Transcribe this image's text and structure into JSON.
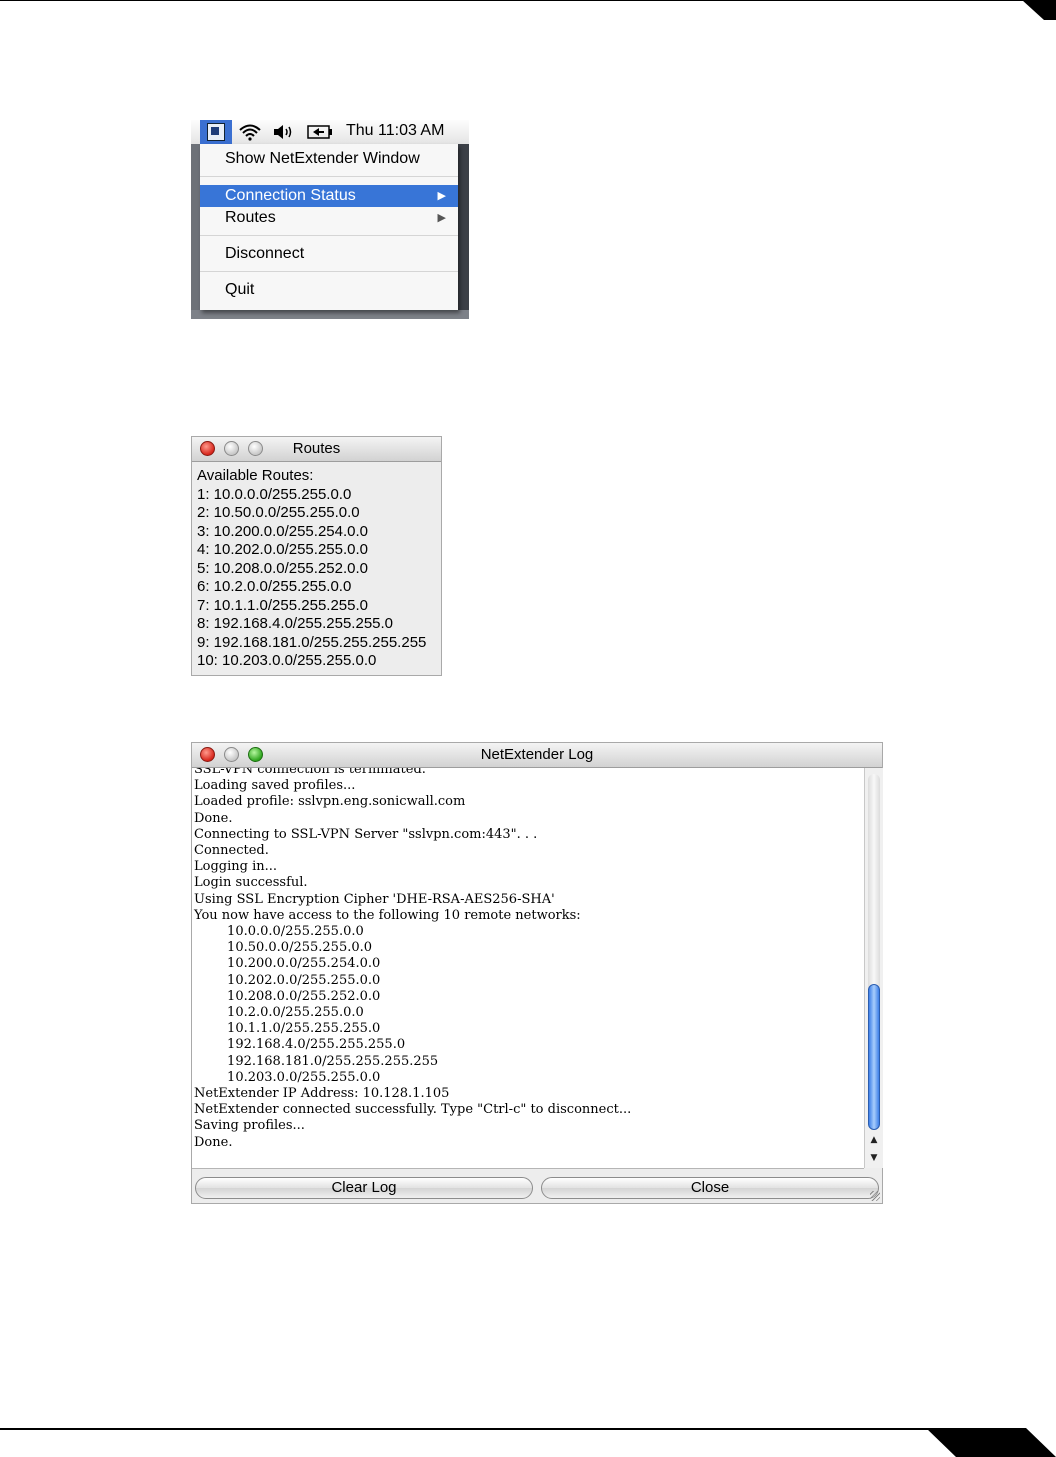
{
  "menubar": {
    "clock": "Thu 11:03 AM",
    "icons": [
      "netextender-icon",
      "wifi-icon",
      "volume-icon",
      "battery-icon"
    ]
  },
  "menu": {
    "items": [
      {
        "label": "Show NetExtender Window"
      },
      {
        "label": "Connection Status",
        "selected": true,
        "submenu": true
      },
      {
        "label": "Routes",
        "submenu": true
      },
      {
        "label": "Disconnect"
      },
      {
        "label": "Quit"
      }
    ]
  },
  "routes_window": {
    "title": "Routes",
    "heading": "Available Routes:",
    "routes": [
      "1: 10.0.0.0/255.255.0.0",
      "2: 10.50.0.0/255.255.0.0",
      "3: 10.200.0.0/255.254.0.0",
      "4: 10.202.0.0/255.255.0.0",
      "5: 10.208.0.0/255.252.0.0",
      "6: 10.2.0.0/255.255.0.0",
      "7: 10.1.1.0/255.255.255.0",
      "8: 192.168.4.0/255.255.255.0",
      "9: 192.168.181.0/255.255.255.255",
      "10: 10.203.0.0/255.255.0.0"
    ]
  },
  "log_window": {
    "title": "NetExtender Log",
    "lines": [
      "SSL-VPN connection is terminated.",
      "Loading saved profiles...",
      "Loaded profile: sslvpn.eng.sonicwall.com",
      "Done.",
      "Connecting to SSL-VPN Server \"sslvpn.com:443\". . .",
      "Connected.",
      "Logging in...",
      "Login successful.",
      "Using SSL Encryption Cipher 'DHE-RSA-AES256-SHA'",
      "You now have access to the following 10 remote networks:",
      "        10.0.0.0/255.255.0.0",
      "        10.50.0.0/255.255.0.0",
      "        10.200.0.0/255.254.0.0",
      "        10.202.0.0/255.255.0.0",
      "        10.208.0.0/255.252.0.0",
      "        10.2.0.0/255.255.0.0",
      "        10.1.1.0/255.255.255.0",
      "        192.168.4.0/255.255.255.0",
      "        192.168.181.0/255.255.255.255",
      "        10.203.0.0/255.255.0.0",
      "NetExtender IP Address: 10.128.1.105",
      "NetExtender connected successfully. Type \"Ctrl-c\" to disconnect...",
      "Saving profiles...",
      "Done."
    ],
    "clear_label": "Clear Log",
    "close_label": "Close"
  }
}
